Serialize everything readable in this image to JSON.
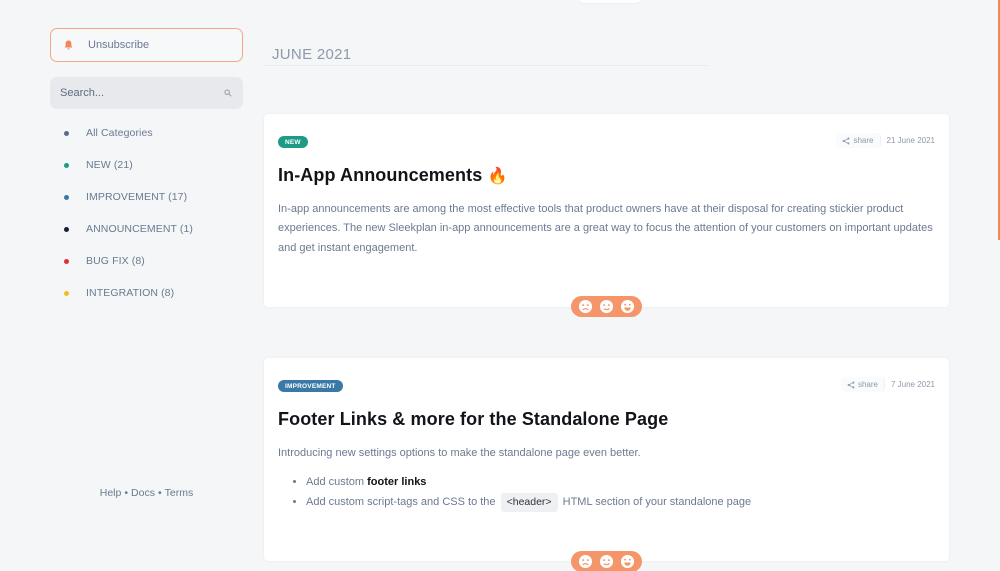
{
  "sidebar": {
    "unsubscribe_label": "Unsubscribe",
    "search": {
      "placeholder": "Search...",
      "value": ""
    },
    "categories": [
      {
        "label": "All Categories",
        "color": "#5b6b8c"
      },
      {
        "label": "NEW (21)",
        "color": "#1f9a86"
      },
      {
        "label": "IMPROVEMENT (17)",
        "color": "#3a79a6"
      },
      {
        "label": "ANNOUNCEMENT (1)",
        "color": "#12213a"
      },
      {
        "label": "BUG FIX (8)",
        "color": "#e52c3a"
      },
      {
        "label": "INTEGRATION (8)",
        "color": "#f6b92b"
      }
    ],
    "footer": {
      "help": "Help",
      "docs": "Docs",
      "terms": "Terms",
      "separator": "•"
    }
  },
  "main": {
    "month_heading": "JUNE 2021",
    "posts": [
      {
        "badge": "NEW",
        "badge_color": "#1f9a86",
        "share_label": "share",
        "date": "21 June 2021",
        "title": "In-App Announcements",
        "title_emoji": "🔥",
        "body": "In-app announcements are among the most effective tools that product owners have at their disposal for creating stickier product experiences. The new Sleekplan in-app announcements are a great way to focus the attention of your customers on important updates and get instant engagement.",
        "reactions": [
          "sad-face",
          "neutral-face",
          "happy-face"
        ]
      },
      {
        "badge": "IMPROVEMENT",
        "badge_color": "#3a79a6",
        "share_label": "share",
        "date": "7 June 2021",
        "title": "Footer Links & more for the Standalone Page",
        "intro": "Introducing new settings options to make the standalone page even better.",
        "bullets": [
          {
            "prefix": "Add custom ",
            "bold": "footer links"
          },
          {
            "prefix": "Add custom script-tags and CSS to the ",
            "code": "<header>",
            "suffix": " HTML section of your standalone page"
          }
        ],
        "reactions": [
          "sad-face",
          "neutral-face",
          "happy-face"
        ]
      }
    ]
  },
  "colors": {
    "accent": "#f4956a",
    "accent_border": "#f4a882",
    "background": "#f4f6f8"
  }
}
